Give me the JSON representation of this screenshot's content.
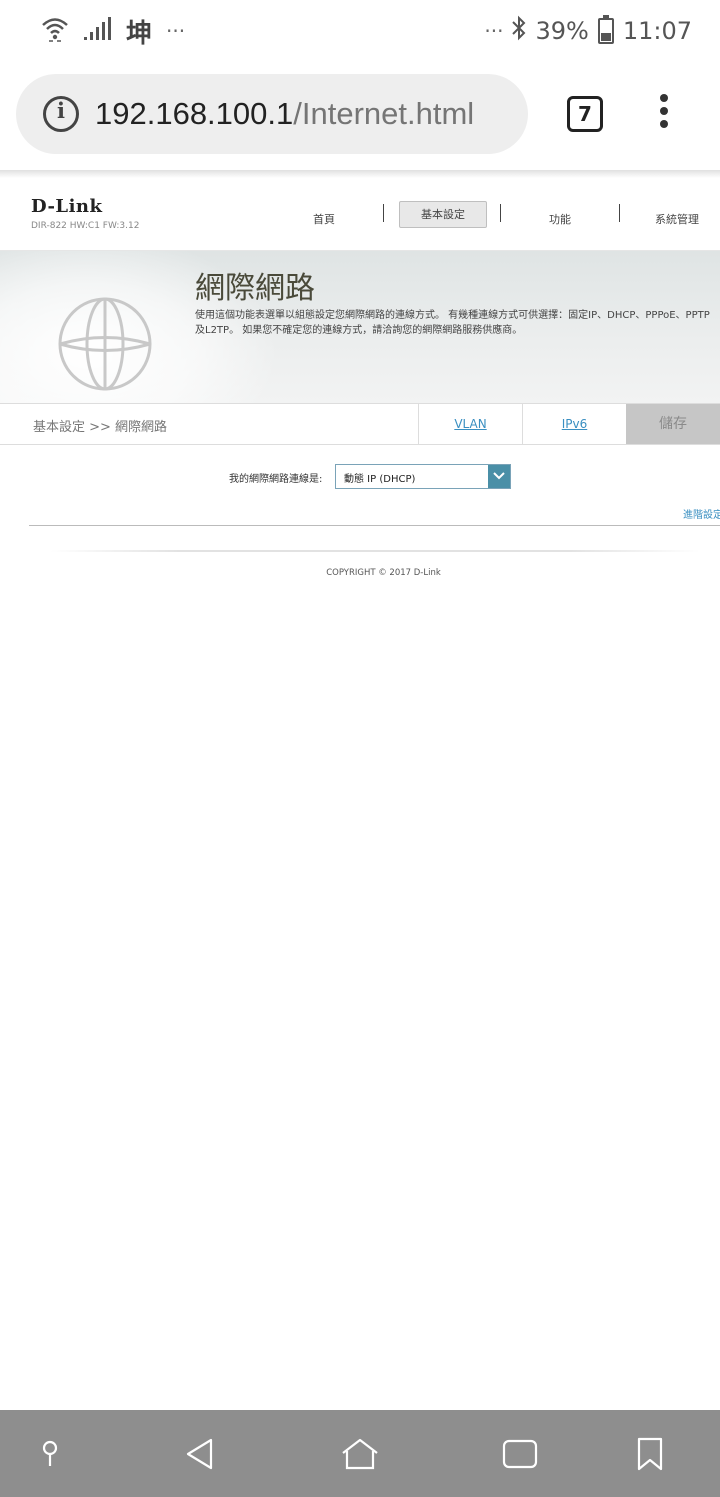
{
  "status_bar": {
    "left_carrier": "坤",
    "left_dots": "···",
    "right_dots": "···",
    "battery": "39%",
    "time": "11:07"
  },
  "browser": {
    "url_host": "192.168.100.1",
    "url_path": "/Internet.html",
    "tab_count": "7"
  },
  "router": {
    "brand": "D-Link",
    "hw_info": "DIR-822 HW:C1 FW:3.12",
    "nav": {
      "home": "首頁",
      "basic": "基本設定",
      "features": "功能",
      "admin": "系統管理"
    },
    "page_title": "網際網路",
    "page_desc": "使用這個功能表選單以組態設定您網際網路的連線方式。 有幾種連線方式可供選擇：固定IP、DHCP、PPPoE、PPTP及L2TP。 如果您不確定您的連線方式，請洽詢您的網際網路服務供應商。",
    "breadcrumb": "基本設定 >> 網際網路",
    "tabs": {
      "vlan": "VLAN",
      "ipv6": "IPv6",
      "save": "儲存"
    },
    "connection_label": "我的網際網路連線是:",
    "connection_value": "動態 IP (DHCP)",
    "advanced_link": "進階設定",
    "copyright": "COPYRIGHT © 2017 D-Link"
  },
  "colors": {
    "accent_link": "#3a8fc1",
    "select_arrow": "#4a8fa7",
    "save_tab_bg": "#c6c6c6",
    "nav_bar_bg": "#8e8e8e"
  }
}
